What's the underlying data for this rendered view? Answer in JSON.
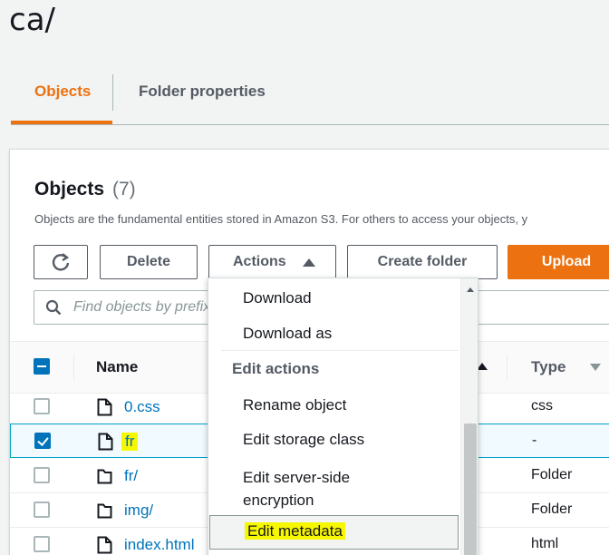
{
  "header": {
    "path": "ca/"
  },
  "tabs": [
    {
      "label": "Objects",
      "active": true
    },
    {
      "label": "Folder properties",
      "active": false
    }
  ],
  "objects_panel": {
    "title": "Objects",
    "count": "(7)",
    "description": "Objects are the fundamental entities stored in Amazon S3. For others to access your objects, y"
  },
  "toolbar": {
    "refresh_icon": "refresh-icon",
    "delete_label": "Delete",
    "actions_label": "Actions",
    "create_folder_label": "Create folder",
    "upload_label": "Upload"
  },
  "search": {
    "placeholder": "Find objects by prefix"
  },
  "table": {
    "headers": {
      "name": "Name",
      "type": "Type"
    },
    "rows": [
      {
        "name": "0.css",
        "type": "css",
        "checked": false
      },
      {
        "name": "fr",
        "type": "-",
        "checked": true
      },
      {
        "name": "fr/",
        "type": "Folder",
        "checked": false
      },
      {
        "name": "img/",
        "type": "Folder",
        "checked": false
      },
      {
        "name": "index.html",
        "type": "html",
        "checked": false
      }
    ]
  },
  "actions_menu": {
    "items": [
      "Download",
      "Download as"
    ],
    "group_label": "Edit actions",
    "edit_items": [
      "Rename object",
      "Edit storage class",
      "Edit server-side",
      "encryption",
      "Edit metadata"
    ]
  },
  "colors": {
    "accent": "#ec7211",
    "link": "#0073bb",
    "highlight": "#f7f700"
  }
}
